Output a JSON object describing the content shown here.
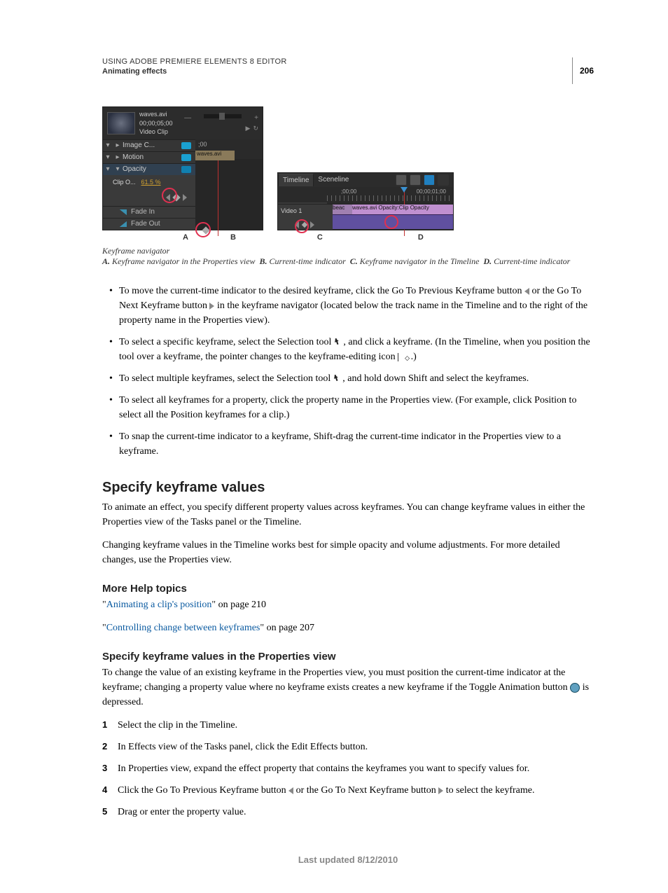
{
  "header": {
    "product": "USING ADOBE PREMIERE ELEMENTS 8 EDITOR",
    "section": "Animating effects",
    "page_number": "206"
  },
  "figure": {
    "props_panel": {
      "clip_name": "waves.avi",
      "clip_time": "00;00;05;00",
      "clip_type": "Video Clip",
      "ruler_start": ";00",
      "ruler_clip": "waves.avi",
      "rows": {
        "image_control": "Image C...",
        "motion": "Motion",
        "opacity": "Opacity",
        "clip_label": "Clip O...",
        "clip_value": "61.5 %",
        "fade_in": "Fade In",
        "fade_out": "Fade Out"
      }
    },
    "timeline_panel": {
      "tab_timeline": "Timeline",
      "tab_sceneline": "Sceneline",
      "ruler_t0": ";00;00",
      "ruler_t1": "00;00;01;00",
      "track_name": "Video 1",
      "clip1": "beac",
      "clip2": "waves.avi Opacity:Clip Opacity"
    },
    "labels": {
      "A": "A",
      "B": "B",
      "C": "C",
      "D": "D"
    },
    "caption_title": "Keyframe navigator",
    "caption_items": {
      "A": {
        "letter": "A.",
        "text": "Keyframe navigator in the Properties view"
      },
      "B": {
        "letter": "B.",
        "text": "Current-time indicator"
      },
      "C": {
        "letter": "C.",
        "text": "Keyframe navigator in the Timeline"
      },
      "D": {
        "letter": "D.",
        "text": "Current-time indicator"
      }
    }
  },
  "bullets": {
    "b1a": "To move the current-time indicator to the desired keyframe, click the Go To Previous Keyframe button ",
    "b1b": " or the Go To Next Keyframe button ",
    "b1c": " in the keyframe navigator (located below the track name in the Timeline and to the right of the property name in the Properties view).",
    "b2a": "To select a specific keyframe, select the Selection tool ",
    "b2b": " , and click a keyframe. (In the Timeline, when you position the tool over a keyframe, the pointer changes to the keyframe-editing icon ",
    "b2c": " .)",
    "b3a": "To select multiple keyframes, select the Selection tool ",
    "b3b": " , and hold down Shift and select the keyframes.",
    "b4": "To select all keyframes for a property, click the property name in the Properties view. (For example, click Position to select all the Position keyframes for a clip.)",
    "b5": "To snap the current-time indicator to a keyframe, Shift-drag the current-time indicator in the Properties view to a keyframe."
  },
  "section_specify": {
    "heading": "Specify keyframe values",
    "para1": "To animate an effect, you specify different property values across keyframes. You can change keyframe values in either the Properties view of the Tasks panel or the Timeline.",
    "para2": "Changing keyframe values in the Timeline works best for simple opacity and volume adjustments. For more detailed changes, use the Properties view."
  },
  "more_help": {
    "heading": "More Help topics",
    "link1": "Animating a clip's position",
    "link1_tail": " on page 210",
    "link2": "Controlling change between keyframes",
    "link2_tail": " on page 207"
  },
  "sub_section": {
    "heading": "Specify keyframe values in the Properties view",
    "intro_a": "To change the value of an existing keyframe in the Properties view, you must position the current-time indicator at the keyframe; changing a property value where no keyframe exists creates a new keyframe if the Toggle Animation button ",
    "intro_b": " is depressed.",
    "steps": {
      "s1": "Select the clip in the Timeline.",
      "s2": "In Effects view of the Tasks panel, click the Edit Effects button.",
      "s3": "In Properties view, expand the effect property that contains the keyframes you want to specify values for.",
      "s4a": "Click the Go To Previous Keyframe button ",
      "s4b": " or the Go To Next Keyframe button ",
      "s4c": " to select the keyframe.",
      "s5": "Drag or enter the property value."
    }
  },
  "footer": "Last updated 8/12/2010"
}
